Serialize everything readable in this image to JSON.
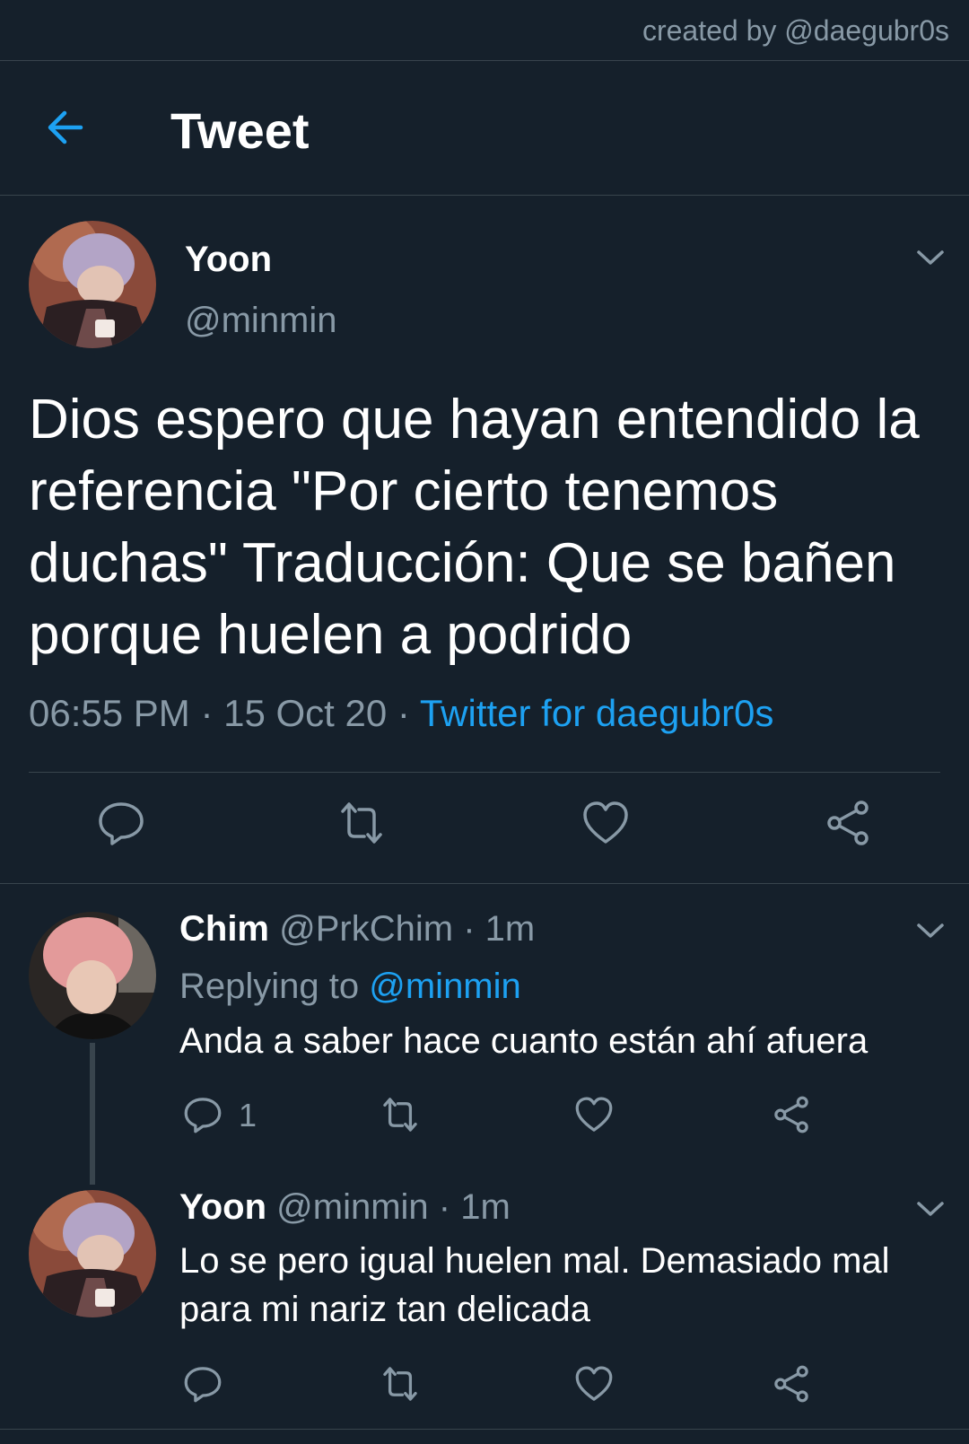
{
  "credit": "created by @daegubr0s",
  "header": {
    "title": "Tweet",
    "back_icon": "arrow-left-icon"
  },
  "main_tweet": {
    "name": "Yoon",
    "handle": "@minmin",
    "text": "Dios espero que hayan entendido la referencia \"Por cierto tenemos duchas\" Traducción: Que se bañen porque huelen a podrido",
    "time": "06:55 PM",
    "date": "15 Oct 20",
    "source": "Twitter for daegubr0s",
    "separator": "·"
  },
  "replies": [
    {
      "name": "Chim",
      "handle": "@PrkChim",
      "age": "1m",
      "replying_to_label": "Replying to",
      "replying_to_handle": "@minmin",
      "text": "Anda a saber hace cuanto están ahí afuera",
      "reply_count": "1"
    },
    {
      "name": "Yoon",
      "handle": "@minmin",
      "age": "1m",
      "text": "Lo se pero igual huelen mal. Demasiado mal para mi nariz tan delicada"
    }
  ],
  "colors": {
    "background": "#15202b",
    "accent": "#1da1f2",
    "muted": "#8899a6",
    "divider": "#38444d"
  }
}
